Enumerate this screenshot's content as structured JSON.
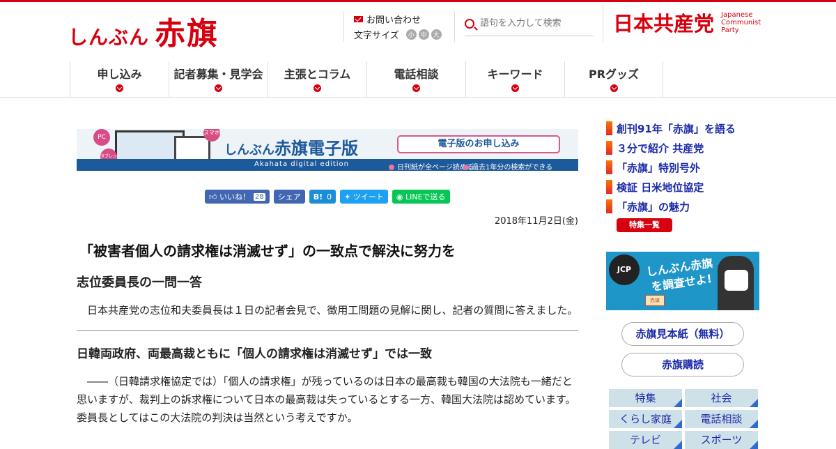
{
  "header": {
    "logo_small": "しんぶん",
    "logo_big": "赤旗",
    "contact": "お問い合わせ",
    "font_size_label": "文字サイズ",
    "font_sizes": [
      "小",
      "中",
      "大"
    ],
    "search_placeholder": "語句を入力して検索",
    "party_name": "日本共産党",
    "party_eng": [
      "Japanese",
      "Communist",
      "Party"
    ]
  },
  "nav": [
    {
      "label": "申し込み"
    },
    {
      "label": "記者募集・見学会"
    },
    {
      "label": "主張とコラム"
    },
    {
      "label": "電話相談"
    },
    {
      "label": "キーワード"
    },
    {
      "label": "PRグッズ"
    }
  ],
  "banner": {
    "title_small": "しんぶん",
    "title_big": "赤旗電子版",
    "subtitle": "Akahata digital edition",
    "apply": "電子版のお申し込み",
    "note1": "日刊紙が全ページ読める",
    "note2": "過去1年分の検索ができる",
    "bubble_pc": "PC",
    "bubble_phone": "スマホ",
    "bubble_tablet": "タブレット"
  },
  "social": {
    "like": "いいね！",
    "like_count": "28",
    "share": "シェア",
    "hatena": "B!",
    "hatena_count": "0",
    "tweet": "ツイート",
    "line": "LINEで送る"
  },
  "article": {
    "date": "2018年11月2日(金)",
    "title": "「被害者個人の請求権は消滅せず」の一致点で解決に努力を",
    "subtitle": "志位委員長の一問一答",
    "lead": "日本共産党の志位和夫委員長は１日の記者会見で、徴用工問題の見解に関し、記者の質問に答えました。",
    "section_title": "日韓両政府、両最高裁ともに「個人の請求権は消滅せず」では一致",
    "body": "――（日韓請求権協定では）「個人の請求権」が残っているのは日本の最高裁も韓国の大法院も一緒だと思いますが、裁判上の訴求権について日本の最高裁は失っているとする一方、韓国大法院は認めています。委員長としてはこの大法院の判決は当然という考えですか。"
  },
  "sidebar": {
    "links": [
      "創刊91年「赤旗」を語る",
      "３分で紹介 共産党",
      "「赤旗」特別号外",
      "検証 日米地位協定",
      "「赤旗」の魅力"
    ],
    "tokushu_button": "特集一覧",
    "promo_badge": "JCP",
    "promo_text": "しんぶん赤旗を調査せよ!",
    "promo_stamp": "赤旗",
    "sample_button": "赤旗見本紙（無料）",
    "subscribe_button": "赤旗購読",
    "categories": [
      "特集",
      "社会",
      "くらし家庭",
      "電話相談",
      "テレビ",
      "スポーツ"
    ]
  }
}
